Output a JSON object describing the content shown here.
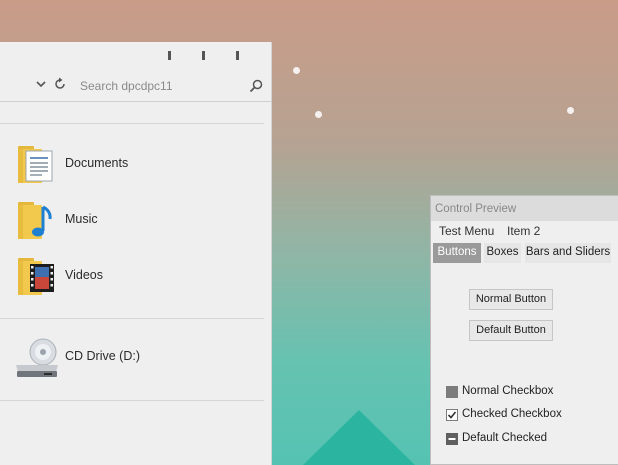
{
  "explorer": {
    "search": {
      "placeholder": "Search dpcdpc11"
    },
    "folders": [
      {
        "label": "Documents",
        "icon": "documents-folder-icon"
      },
      {
        "label": "Music",
        "icon": "music-folder-icon"
      },
      {
        "label": "Videos",
        "icon": "videos-folder-icon"
      }
    ],
    "drives": [
      {
        "label": "CD Drive (D:)",
        "icon": "cd-drive-icon"
      }
    ]
  },
  "preview": {
    "title": "Control Preview",
    "menu": [
      "Test Menu",
      "Item 2"
    ],
    "tabs": [
      {
        "label": "Buttons",
        "active": true
      },
      {
        "label": "Boxes",
        "active": false
      },
      {
        "label": "Bars and Sliders",
        "active": false
      }
    ],
    "buttons": {
      "normal": "Normal Button",
      "default": "Default Button"
    },
    "checkboxes": [
      {
        "label": "Normal Checkbox",
        "state": "unchecked"
      },
      {
        "label": "Checked Checkbox",
        "state": "checked"
      },
      {
        "label": "Default Checked",
        "state": "indeterminate"
      }
    ]
  },
  "colors": {
    "folder": "#f2c94c",
    "music_note": "#1f7fd1",
    "active_tab": "#9a9a9a",
    "teal_triangle": "#2bb5a1"
  }
}
